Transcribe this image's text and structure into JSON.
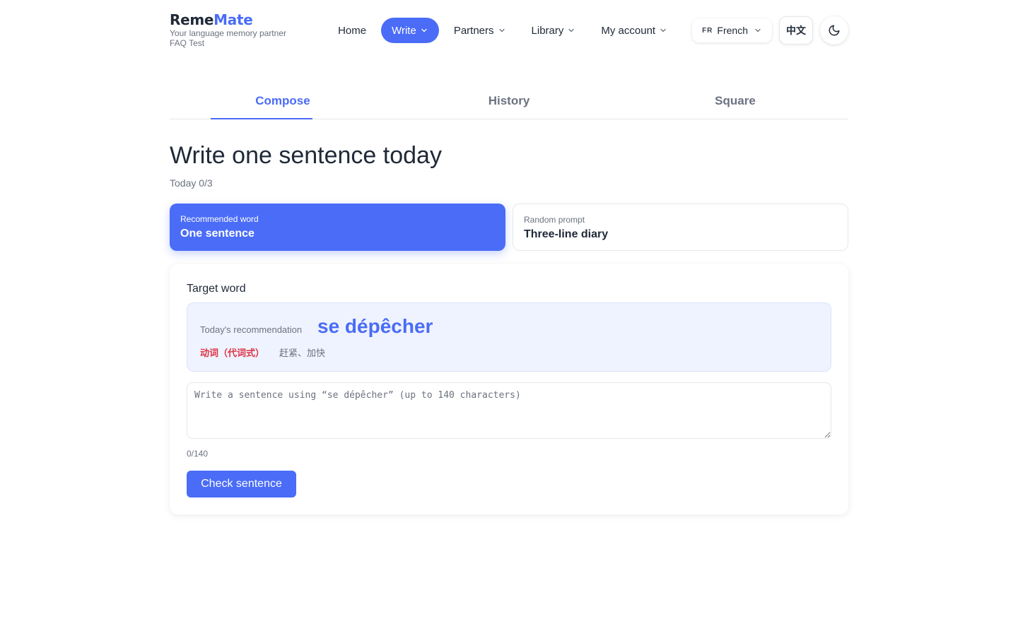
{
  "brand": {
    "name_part1": "Reme",
    "name_part2": "Mate",
    "tagline": "Your language memory partner",
    "subtitle": "FAQ Test"
  },
  "nav": {
    "home": "Home",
    "write": "Write",
    "partners": "Partners",
    "library": "Library",
    "account": "My account",
    "lang_code": "FR",
    "lang_name": "French",
    "ui_lang": "中文"
  },
  "tabs": [
    "Compose",
    "History",
    "Square"
  ],
  "page": {
    "title": "Write one sentence today",
    "today_count": "Today 0/3"
  },
  "options": {
    "recommended_label": "Recommended word",
    "recommended_title": "One sentence",
    "random_label": "Random prompt",
    "random_title": "Three-line diary"
  },
  "target": {
    "label": "Target word",
    "rec_label": "Today's recommendation",
    "word": "se dépêcher",
    "pos": "动词（代词式）",
    "meaning": "赶紧、加快"
  },
  "input": {
    "placeholder": "Write a sentence using “se dépêcher” (up to 140 characters)",
    "value": "",
    "counter": "0/140"
  },
  "actions": {
    "check": "Check sentence"
  },
  "colors": {
    "accent": "#4a6cf7",
    "pos_red": "#dc3545",
    "text": "#1f2937",
    "muted": "#6b7280"
  }
}
